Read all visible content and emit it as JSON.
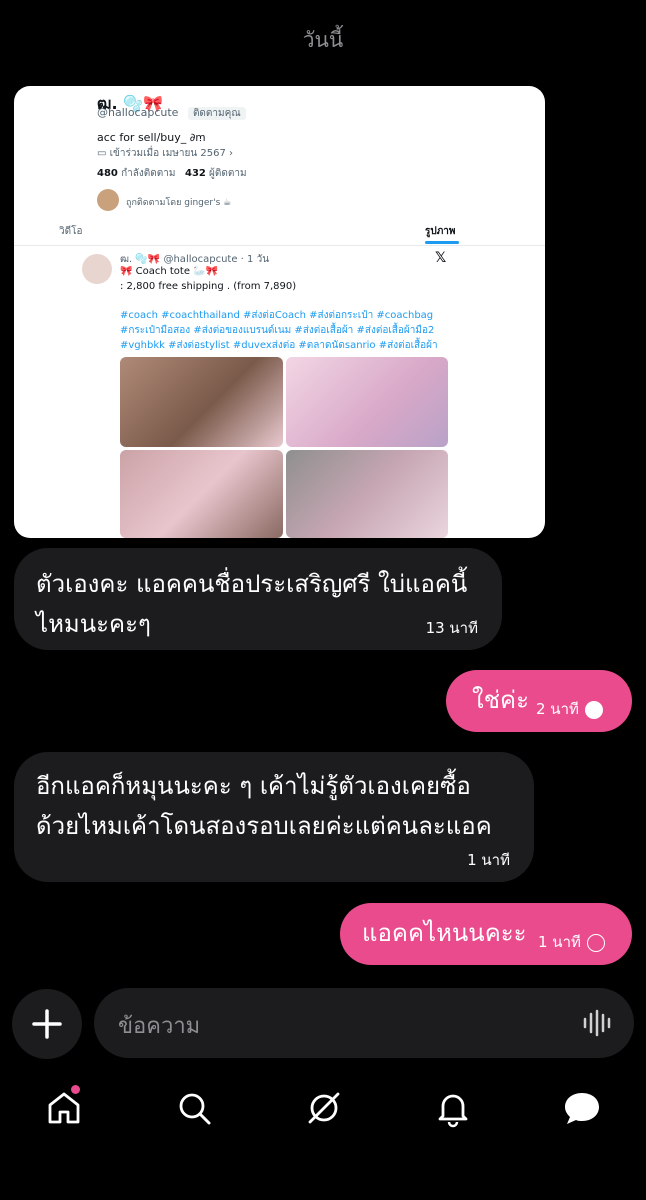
{
  "date_label": "วันนี้",
  "card": {
    "display_name": "ฒ. 🫧🎀",
    "handle": "@hallocapcute",
    "follows_you": "ติดตามคุณ",
    "bio": "acc for sell/buy_ ∂ꭑ",
    "joined": "เข้าร่วมเมื่อ เมษายน 2567",
    "following_count": "480",
    "following_label": "กำลังติดตาม",
    "followers_count": "432",
    "followers_label": "ผู้ติดตาม",
    "followed_by": "ถูกติดตามโดย ginger's ☕",
    "tabs": [
      "วิดีโอ",
      "รูปภาพ"
    ],
    "tweet": {
      "author": "ฒ. 🫧🎀 @hallocapcute · 1 วัน",
      "line1": "🎀 Coach tote 🦢🎀",
      "line2": ": 2,800 free shipping . (from 7,890)",
      "hashtags": "#coach #coachthailand #ส่งต่อCoach #ส่งต่อกระเป๋า #coachbag #กระเป๋ามือสอง #ส่งต่อของแบรนด์เนม #ส่งต่อเสื้อผ้า #ส่งต่อเสื้อผ้ามือ2 #vghbkk #ส่งต่อstylist #duvexส่งต่อ #ตลาดนัดsanrio #ส่งต่อเสื้อผ้า"
    }
  },
  "messages": [
    {
      "side": "in",
      "text_line1": "ตัวเองคะ แอคคนชื่อประเสริญศรี ใบ่แอคนี้",
      "text_line2": "ไหมนะคะๆ",
      "time": "13 นาที"
    },
    {
      "side": "out",
      "text": "ใช่ค่ะ",
      "time": "2 นาที"
    },
    {
      "side": "in",
      "text_line1": "อีกแอคก็หมุนนะคะ ๆ เค้าไม่รู้ตัวเองเคยซื้อ",
      "text_line2": "ด้วยไหมเค้าโดนสองรอบเลยค่ะแต่คนละแอค",
      "time": "1 นาที"
    },
    {
      "side": "out",
      "text": "แอคคไหนนคะะ",
      "time": "1 นาที"
    }
  ],
  "composer": {
    "placeholder": "ข้อความ"
  },
  "nav": [
    "home-icon",
    "search-icon",
    "communities-icon",
    "notifications-icon",
    "messages-icon"
  ],
  "colors": {
    "accent": "#e94b8c",
    "bubble_in": "#1c1c1e",
    "background": "#000000"
  }
}
